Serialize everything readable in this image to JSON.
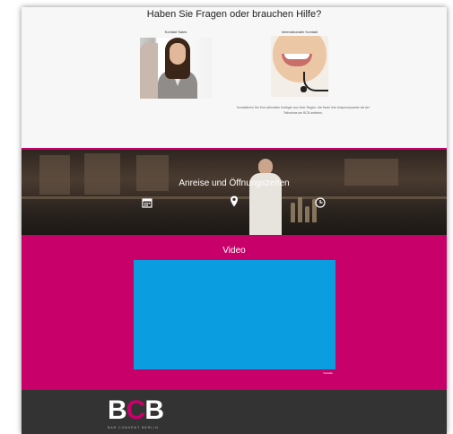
{
  "help": {
    "title": "Haben Sie Fragen oder brauchen Hilfe?",
    "sales_label": "Kontakt Sales",
    "intl_label": "Internationaler Kontakt",
    "note": "Kontaktieren Sie Ihre nationalen Kollegen aus Ihrer Region, die Ihnen Ihre Ansprechpartner bei der Teilnahme am BCB anbieten."
  },
  "anreise": {
    "title": "Anreise und Öffnungszeiten",
    "icons": [
      "calendar-icon",
      "location-pin-icon",
      "clock-icon"
    ]
  },
  "video": {
    "title": "Video",
    "note": "Youtube"
  },
  "footer": {
    "logo": "BCB",
    "tagline": "BAR CONVENT BERLIN"
  },
  "colors": {
    "accent": "#c8006a",
    "video": "#0a9ee0",
    "footer": "#333333"
  }
}
